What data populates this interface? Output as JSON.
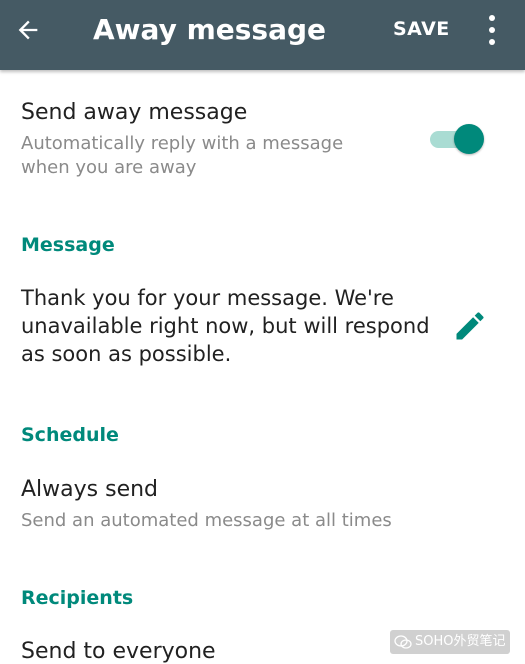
{
  "appbar": {
    "title": "Away message",
    "save_label": "SAVE",
    "icons": {
      "back": "arrow-back-icon",
      "more": "more-vert-icon"
    }
  },
  "away_toggle": {
    "title": "Send away message",
    "subtitle_line1": "Automatically reply with a message",
    "subtitle_line2": "when you are away",
    "enabled": true
  },
  "message_section": {
    "header": "Message",
    "lines": [
      "Thank you for your message. We're",
      "unavailable right now, but will respond",
      "as soon as possible."
    ],
    "edit_icon": "pencil-icon"
  },
  "schedule_section": {
    "header": "Schedule",
    "title": "Always send",
    "subtitle": "Send an automated message at all times"
  },
  "recipients_section": {
    "header": "Recipients",
    "title": "Send to everyone"
  },
  "watermark": {
    "text": "SOHO外贸笔记"
  },
  "colors": {
    "appbar": "#455a64",
    "accent": "#00897b",
    "toggle_track": "#a9dcd3",
    "text_primary": "#212121",
    "text_secondary": "#8a8a8a"
  }
}
